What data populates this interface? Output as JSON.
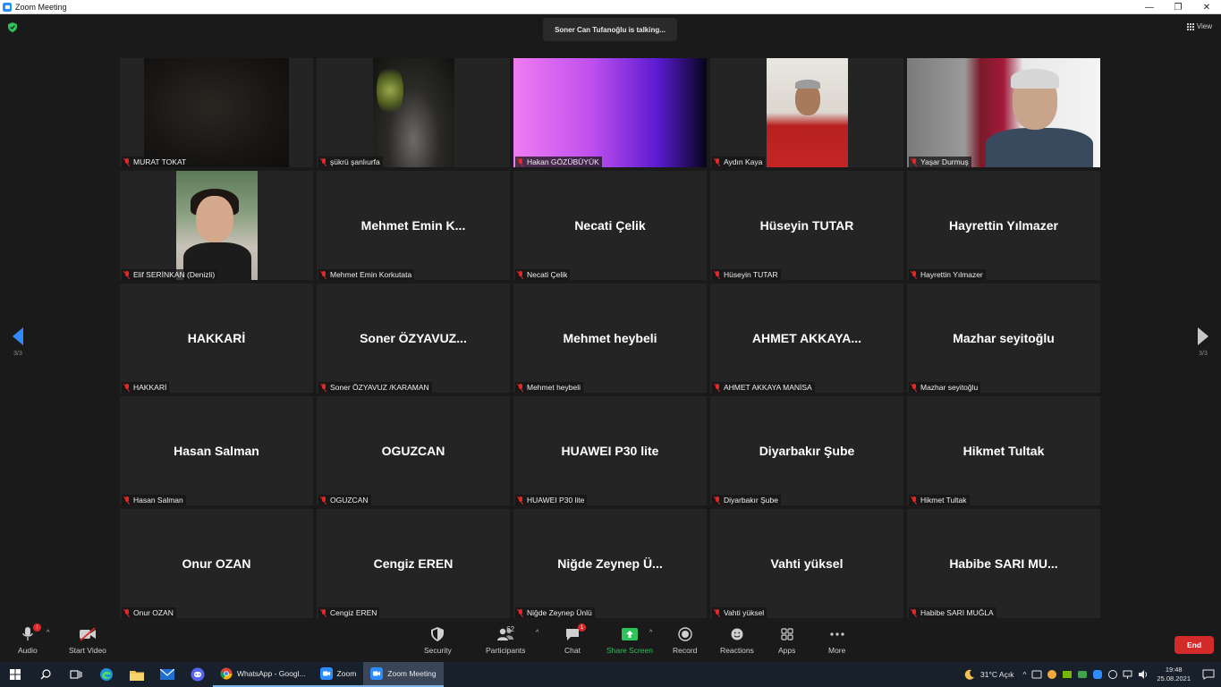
{
  "window": {
    "title": "Zoom Meeting",
    "controls": [
      "—",
      "❐",
      "✕"
    ]
  },
  "meeting": {
    "talking_banner": "Soner Can Tufanoğlu is talking...",
    "view_label": "View",
    "page_left": "3/3",
    "page_right": "3/3"
  },
  "tiles": [
    {
      "big": "",
      "label": "MURAT TOKAT"
    },
    {
      "big": "",
      "label": "şükrü şanlıurfa"
    },
    {
      "big": "",
      "label": "Hakan GÖZÜBÜYÜK"
    },
    {
      "big": "",
      "label": "Aydın Kaya"
    },
    {
      "big": "",
      "label": "Yaşar Durmuş"
    },
    {
      "big": "",
      "label": "Elif SERİNKAN (Denizli)"
    },
    {
      "big": "Mehmet  Emin  K...",
      "label": "Mehmet Emin Korkutata"
    },
    {
      "big": "Necati Çelik",
      "label": "Necati Çelik"
    },
    {
      "big": "Hüseyin TUTAR",
      "label": "Hüseyin TUTAR"
    },
    {
      "big": "Hayrettin Yılmazer",
      "label": "Hayrettin Yılmazer"
    },
    {
      "big": "HAKKARİ",
      "label": "HAKKARİ"
    },
    {
      "big": "Soner  ÖZYAVUZ...",
      "label": "Soner ÖZYAVUZ /KARAMAN"
    },
    {
      "big": "Mehmet heybeli",
      "label": "Mehmet heybeli"
    },
    {
      "big": "AHMET  AKKAYA...",
      "label": "AHMET AKKAYA MANİSA"
    },
    {
      "big": "Mazhar seyitoğlu",
      "label": "Mazhar seyitoğlu"
    },
    {
      "big": "Hasan Salman",
      "label": "Hasan Salman"
    },
    {
      "big": "OGUZCAN",
      "label": "OGUZCAN"
    },
    {
      "big": "HUAWEI P30 lite",
      "label": "HUAWEI P30 lite"
    },
    {
      "big": "Diyarbakır Şube",
      "label": "Diyarbakır Şube"
    },
    {
      "big": "Hikmet Tultak",
      "label": "Hikmet Tultak"
    },
    {
      "big": "Onur OZAN",
      "label": "Onur OZAN"
    },
    {
      "big": "Cengiz EREN",
      "label": "Cengiz EREN"
    },
    {
      "big": "Niğde Zeynep Ü...",
      "label": "Niğde Zeynep Ünlü"
    },
    {
      "big": "Vahti yüksel",
      "label": "Vahti yüksel"
    },
    {
      "big": "Habibe SARI MU...",
      "label": "Habibe SARI MUĞLA"
    }
  ],
  "toolbar": {
    "audio": "Audio",
    "audio_badge": "!",
    "start_video": "Start Video",
    "security": "Security",
    "participants": "Participants",
    "participants_count": "62",
    "chat": "Chat",
    "chat_badge": "1",
    "share_screen": "Share Screen",
    "record": "Record",
    "reactions": "Reactions",
    "apps": "Apps",
    "more": "More",
    "end": "End"
  },
  "taskbar": {
    "apps": [
      {
        "label": "WhatsApp - Googl...",
        "icon": "chrome-icon"
      },
      {
        "label": "Zoom",
        "icon": "zoom-icon"
      },
      {
        "label": "Zoom Meeting",
        "icon": "zoom-icon"
      }
    ],
    "weather": "31°C  Açık",
    "time": "19:48",
    "date": "25.08.2021"
  },
  "colors": {
    "accent": "#2d8cff",
    "muted_red": "#e02828",
    "share_green": "#2ec25a",
    "end_red": "#d32a2a"
  }
}
